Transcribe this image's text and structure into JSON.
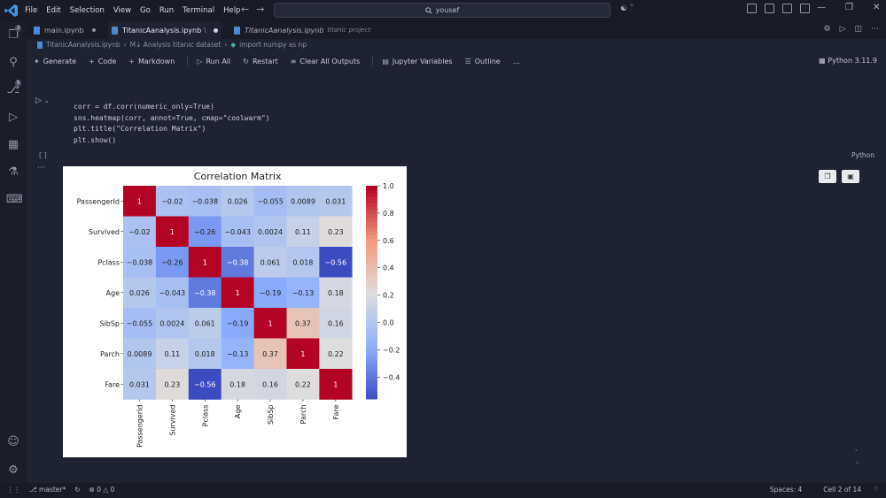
{
  "menu": [
    "File",
    "Edit",
    "Selection",
    "View",
    "Go",
    "Run",
    "Terminal",
    "Help"
  ],
  "search_text": "yousef",
  "tabs": [
    {
      "label": "main.ipynb"
    },
    {
      "label": "TitanicAanalysis.ipynb",
      "suffix": "\\"
    },
    {
      "label": "TitanicAanalysis.ipynb",
      "desc": "titanic project"
    }
  ],
  "breadcrumb": [
    "TitanicAanalysis.ipynb",
    "M↓ Analysis titanic dataset",
    "import numpy as np"
  ],
  "toolbar": {
    "generate": "Generate",
    "code": "Code",
    "markdown": "Markdown",
    "run_all": "Run All",
    "restart": "Restart",
    "clear_all": "Clear All Outputs",
    "variables": "Jupyter Variables",
    "outline": "Outline",
    "more": "…"
  },
  "kernel": "Python 3.11.9",
  "code_lines": [
    "corr = df.corr(numeric_only=True)",
    "sns.heatmap(corr, annot=True, cmap=\"coolwarm\")",
    "plt.title(\"Correlation Matrix\")",
    "plt.show()"
  ],
  "exec_count": "[ ]",
  "cell_lang": "Python",
  "status": {
    "branch": "master*",
    "errors": "0",
    "warnings": "0",
    "spaces": "Spaces: 4",
    "cell": "Cell 2 of 14"
  },
  "chart_data": {
    "type": "heatmap",
    "title": "Correlation Matrix",
    "labels": [
      "PassengerId",
      "Survived",
      "Pclass",
      "Age",
      "SibSp",
      "Parch",
      "Fare"
    ],
    "values": [
      [
        1,
        -0.02,
        -0.038,
        0.026,
        -0.055,
        0.0089,
        0.031
      ],
      [
        -0.02,
        1,
        -0.26,
        -0.043,
        0.0024,
        0.11,
        0.23
      ],
      [
        -0.038,
        -0.26,
        1,
        -0.38,
        0.061,
        0.018,
        -0.56
      ],
      [
        0.026,
        -0.043,
        -0.38,
        1,
        -0.19,
        -0.13,
        0.18
      ],
      [
        -0.055,
        0.0024,
        0.061,
        -0.19,
        1,
        0.37,
        0.16
      ],
      [
        0.0089,
        0.11,
        0.018,
        -0.13,
        0.37,
        1,
        0.22
      ],
      [
        0.031,
        0.23,
        -0.56,
        0.18,
        0.16,
        0.22,
        1
      ]
    ],
    "colormap": "coolwarm",
    "vmin": -0.56,
    "vmax": 1,
    "colorbar_ticks": [
      1.0,
      0.8,
      0.6,
      0.4,
      0.2,
      0.0,
      -0.2,
      -0.4
    ],
    "colorbar_tick_labels": [
      "1.0",
      "0.8",
      "0.6",
      "0.4",
      "0.2",
      "0.0",
      "−0.2",
      "−0.4"
    ]
  }
}
